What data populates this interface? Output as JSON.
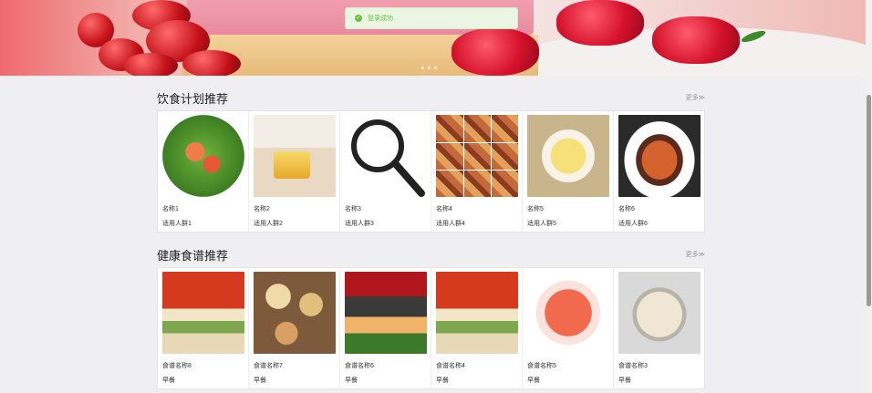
{
  "toast": {
    "message": "登录成功"
  },
  "plans": {
    "title": "饮食计划推荐",
    "more": "更多≫",
    "items": [
      {
        "name": "名称1",
        "audience": "适用人群1",
        "image": "salad"
      },
      {
        "name": "名称2",
        "audience": "适用人群2",
        "image": "honey"
      },
      {
        "name": "名称3",
        "audience": "适用人群3",
        "image": "search-icon"
      },
      {
        "name": "名称4",
        "audience": "适用人群4",
        "image": "dishes-collage"
      },
      {
        "name": "名称5",
        "audience": "适用人群5",
        "image": "shrimp-plate"
      },
      {
        "name": "名称6",
        "audience": "适用人群6",
        "image": "salmon"
      }
    ]
  },
  "recipes": {
    "title": "健康食谱推荐",
    "more": "更多≫",
    "items": [
      {
        "name": "食谱名称8",
        "meal": "早餐",
        "image": "poster"
      },
      {
        "name": "食谱名称7",
        "meal": "早餐",
        "image": "table-dishes"
      },
      {
        "name": "食谱名称6",
        "meal": "早餐",
        "image": "fish"
      },
      {
        "name": "食谱名称4",
        "meal": "早餐",
        "image": "poster"
      },
      {
        "name": "食谱名称5",
        "meal": "早餐",
        "image": "prawns"
      },
      {
        "name": "食谱名称3",
        "meal": "早餐",
        "image": "rice"
      }
    ]
  }
}
